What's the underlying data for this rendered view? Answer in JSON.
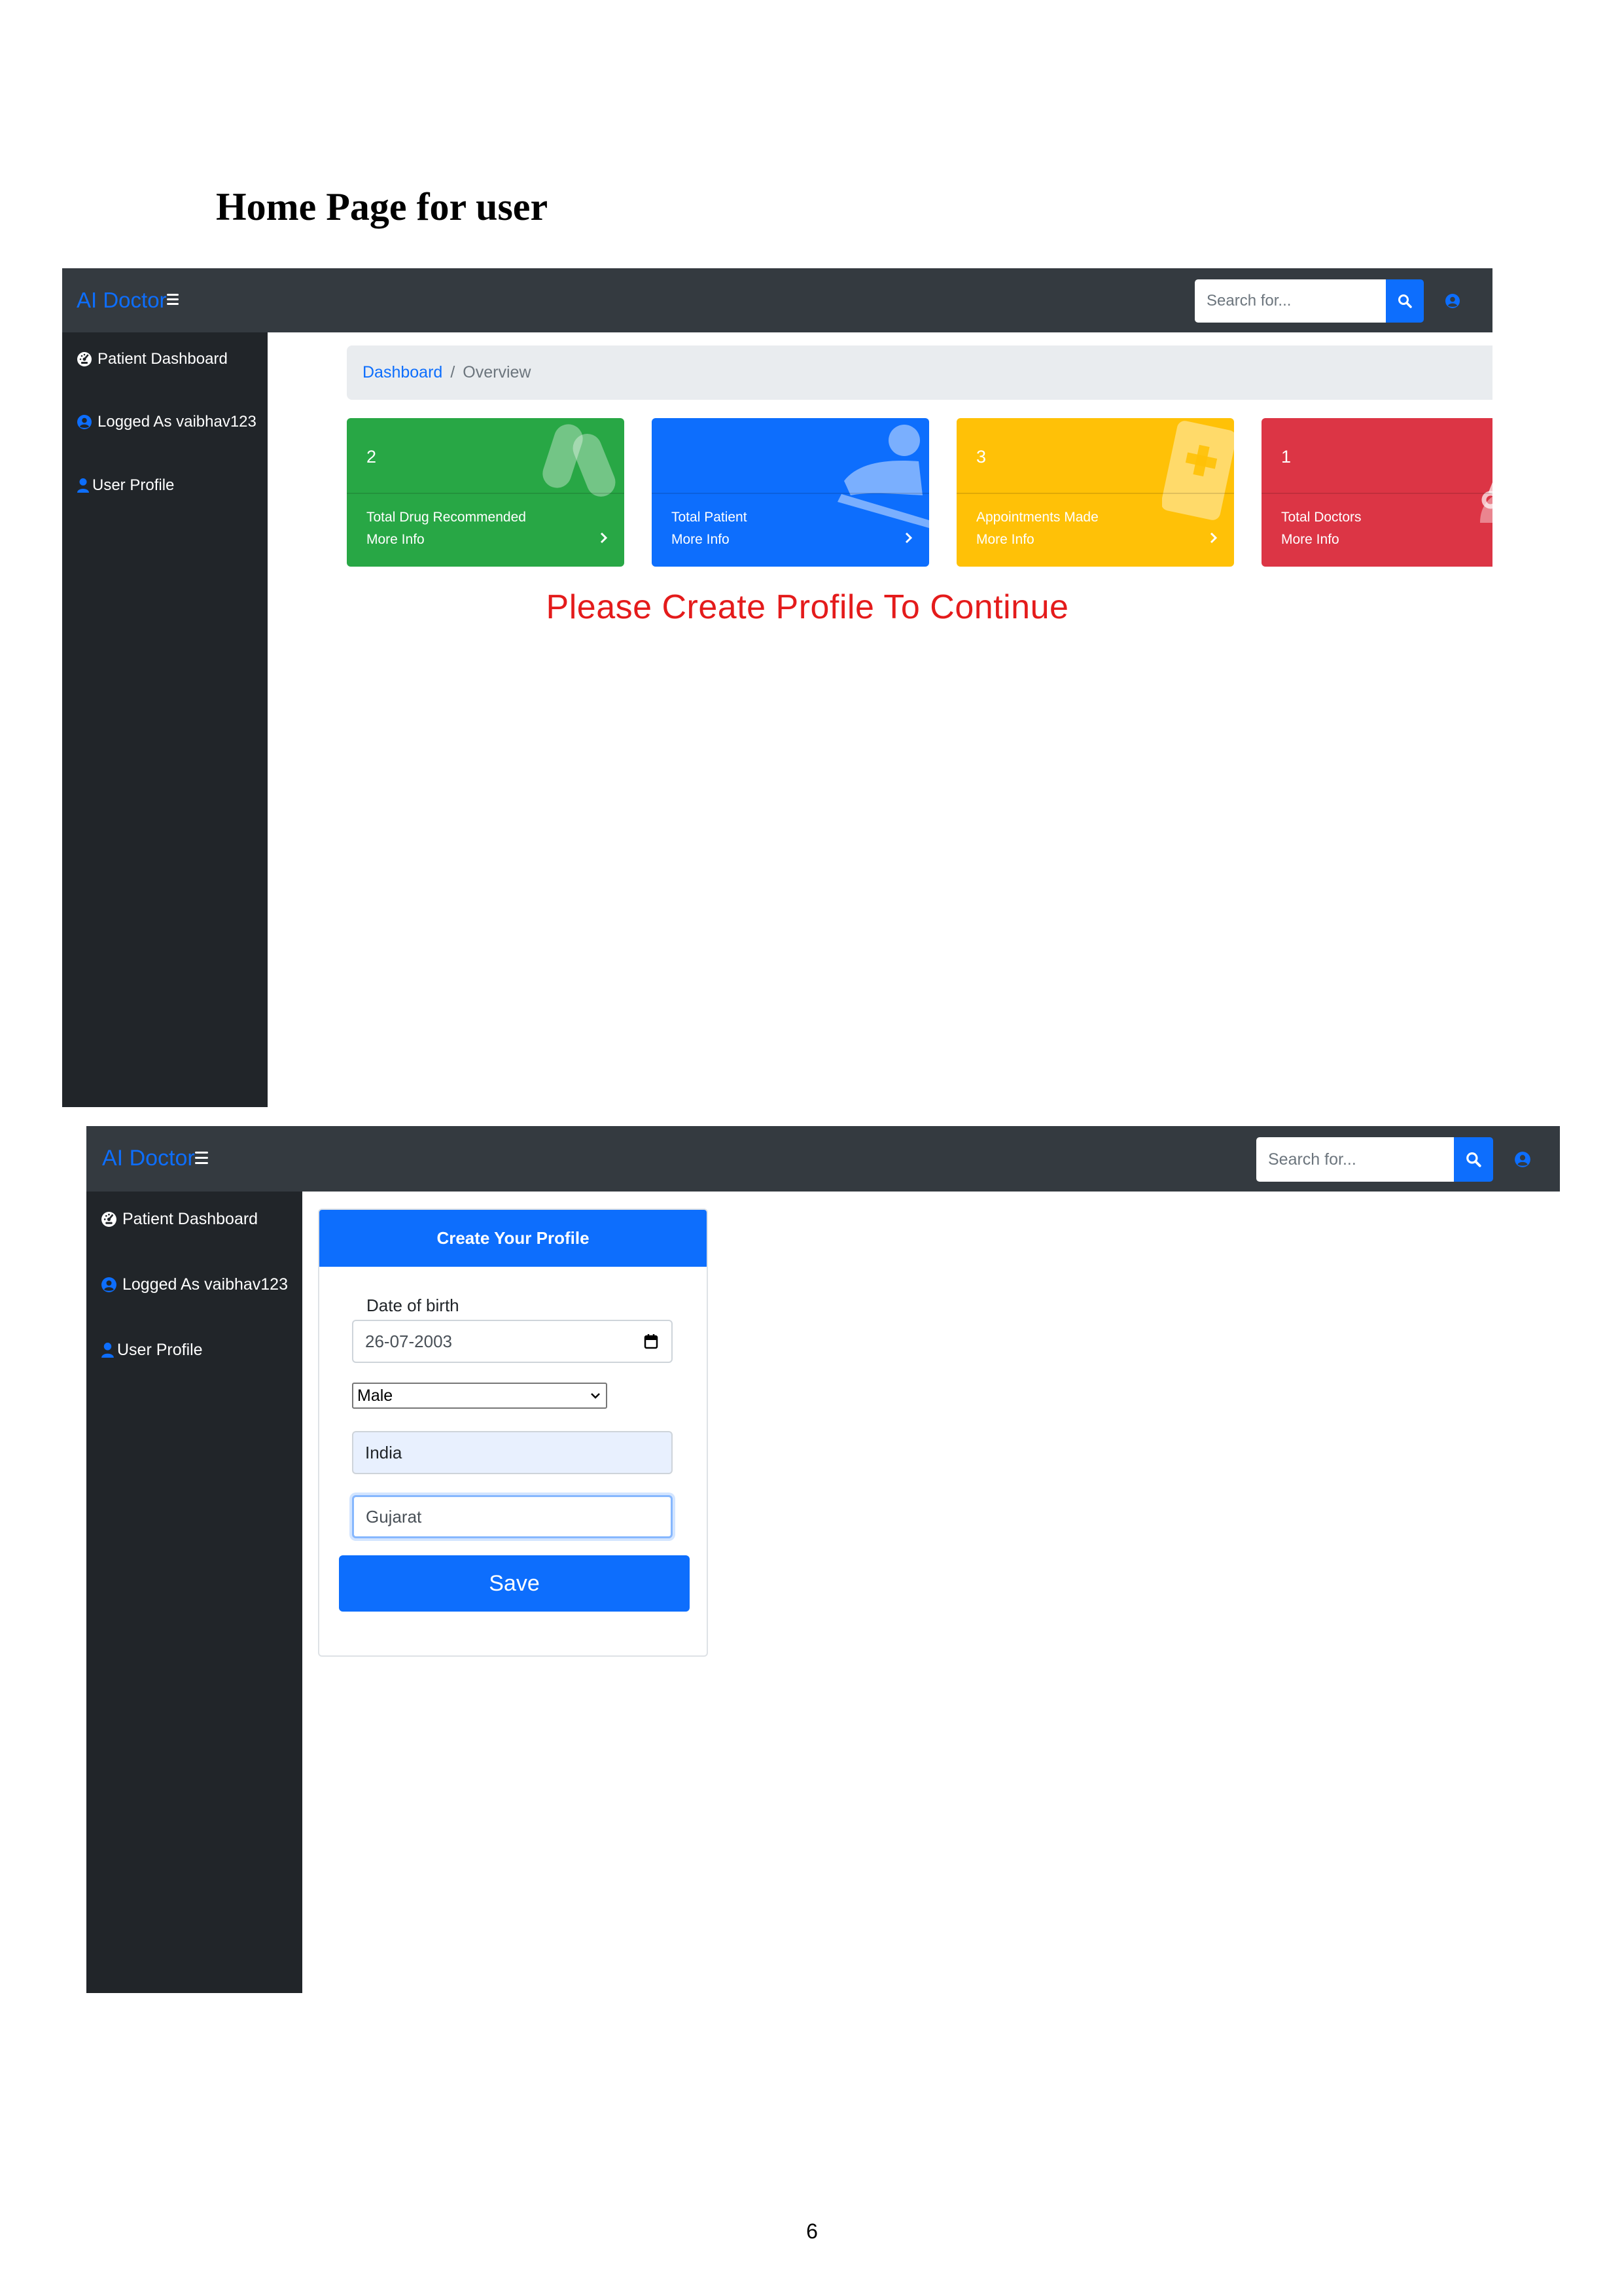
{
  "document": {
    "heading": "Home Page for user",
    "page_number": "6"
  },
  "app": {
    "brand": "AI Doctor",
    "search_placeholder": "Search for...",
    "colors": {
      "topbar": "#343a40",
      "sidebar": "#212529",
      "primary": "#0d6efd",
      "success": "#28a745",
      "warning": "#ffc107",
      "danger": "#dc3545",
      "notice": "#e41b1b"
    }
  },
  "sidebar": {
    "items": [
      {
        "label": "Patient Dashboard",
        "icon": "tachometer-icon"
      },
      {
        "label": "Logged As vaibhav123",
        "icon": "user-circle-icon"
      },
      {
        "label": "User Profile",
        "icon": "user-icon"
      }
    ]
  },
  "dashboard": {
    "breadcrumb": {
      "link": "Dashboard",
      "separator": "/",
      "current": "Overview"
    },
    "cards": [
      {
        "value": "2",
        "label": "Total Drug Recommended",
        "more": "More Info",
        "color": "#28a745",
        "icon": "pills-icon"
      },
      {
        "value": "",
        "label": "Total Patient",
        "more": "More Info",
        "color": "#0d6efd",
        "icon": "procedures-icon"
      },
      {
        "value": "3",
        "label": "Appointments Made",
        "more": "More Info",
        "color": "#ffc107",
        "icon": "notes-medical-icon"
      },
      {
        "value": "1",
        "label": "Total Doctors",
        "more": "More Info",
        "color": "#dc3545",
        "icon": "user-md-icon"
      }
    ],
    "notice": "Please Create Profile To Continue"
  },
  "profile_form": {
    "title": "Create Your Profile",
    "dob_label": "Date of birth",
    "dob_value": "26-07-2003",
    "gender_value": "Male",
    "country_value": "India",
    "state_value": "Gujarat",
    "save_label": "Save"
  }
}
